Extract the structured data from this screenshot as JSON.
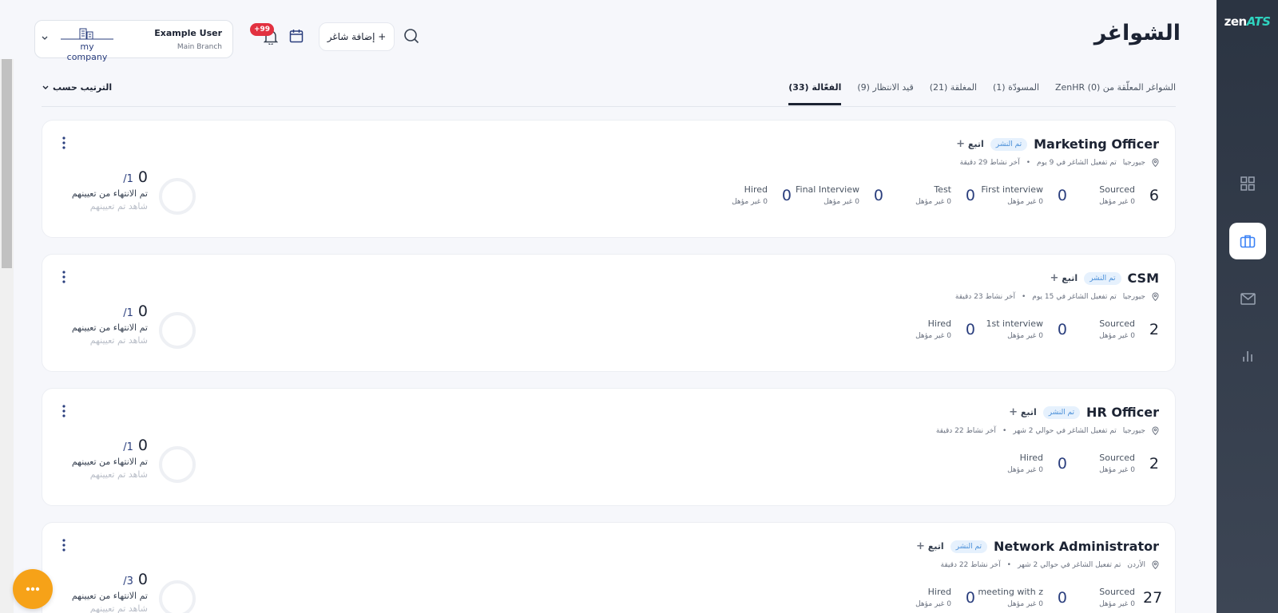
{
  "brand": {
    "zen": "zen",
    "ats": "ATS"
  },
  "header": {
    "title": "الشواغر",
    "add_vacancy": "+ إضافة شاغر",
    "notifications_badge": "+99",
    "user_name": "Example User",
    "branch": "Main Branch",
    "company": "my company"
  },
  "tabs": [
    {
      "label": "الفعّالة (33)"
    },
    {
      "label": "قيد الانتظار (9)"
    },
    {
      "label": "المغلقة (21)"
    },
    {
      "label": "المسودّة (1)"
    },
    {
      "label": "الشواغر المعلّقة من ZenHR (0)"
    }
  ],
  "sort_label": "الترتيب حسب",
  "jobs": [
    {
      "title": "Marketing Officer",
      "status": "تم النشر",
      "follow": "اتبع",
      "location": "جيورجيا",
      "activated": "تم تفعيل الشاغر في 9 يوم",
      "last_activity": "آخر نشاط 29 دقيقة",
      "stages": [
        {
          "name": "Sourced",
          "count": "6",
          "unqualified": "0 غير مؤهل"
        },
        {
          "name": "First interview",
          "count": "0",
          "unqualified": "0 غير مؤهل"
        },
        {
          "name": "Test",
          "count": "0",
          "unqualified": "0 غير مؤهل"
        },
        {
          "name": "Final Interview",
          "count": "0",
          "unqualified": "0 غير مؤهل"
        },
        {
          "name": "Hired",
          "count": "0",
          "unqualified": "0 غير مؤهل"
        }
      ],
      "hired": "0",
      "hired_total": "/1",
      "hired_label": "تم الانتهاء من تعيينهم",
      "hired_sub": "شاهد تم تعيينهم"
    },
    {
      "title": "CSM",
      "status": "تم النشر",
      "follow": "اتبع",
      "location": "جيورجيا",
      "activated": "تم تفعيل الشاغر في 15 يوم",
      "last_activity": "آخر نشاط 23 دقيقة",
      "stages": [
        {
          "name": "Sourced",
          "count": "2",
          "unqualified": "0 غير مؤهل"
        },
        {
          "name": "1st interview",
          "count": "0",
          "unqualified": "0 غير مؤهل"
        },
        {
          "name": "Hired",
          "count": "0",
          "unqualified": "0 غير مؤهل"
        }
      ],
      "hired": "0",
      "hired_total": "/1",
      "hired_label": "تم الانتهاء من تعيينهم",
      "hired_sub": "شاهد تم تعيينهم"
    },
    {
      "title": "HR Officer",
      "status": "تم النشر",
      "follow": "اتبع",
      "location": "جيورجيا",
      "activated": "تم تفعيل الشاغر في حوالي 2 شهر",
      "last_activity": "آخر نشاط 22 دقيقة",
      "stages": [
        {
          "name": "Sourced",
          "count": "2",
          "unqualified": "0 غير مؤهل"
        },
        {
          "name": "Hired",
          "count": "0",
          "unqualified": "0 غير مؤهل"
        }
      ],
      "hired": "0",
      "hired_total": "/1",
      "hired_label": "تم الانتهاء من تعيينهم",
      "hired_sub": "شاهد تم تعيينهم"
    },
    {
      "title": "Network Administrator",
      "status": "تم النشر",
      "follow": "اتبع",
      "location": "الأردن",
      "activated": "تم تفعيل الشاغر في حوالي 2 شهر",
      "last_activity": "آخر نشاط 22 دقيقة",
      "stages": [
        {
          "name": "Sourced",
          "count": "27",
          "unqualified": "0 غير مؤهل"
        },
        {
          "name": "meeting with z",
          "count": "0",
          "unqualified": "0 غير مؤهل"
        },
        {
          "name": "Hired",
          "count": "0",
          "unqualified": "0 غير مؤهل"
        }
      ],
      "hired": "0",
      "hired_total": "/3",
      "hired_label": "تم الانتهاء من تعيينهم",
      "hired_sub": "شاهد تم تعيينهم"
    }
  ],
  "colors": {
    "accent": "#2a3e7d",
    "sidebar": "#2b3442",
    "fab": "#f6a218",
    "badge": "#e23140"
  }
}
